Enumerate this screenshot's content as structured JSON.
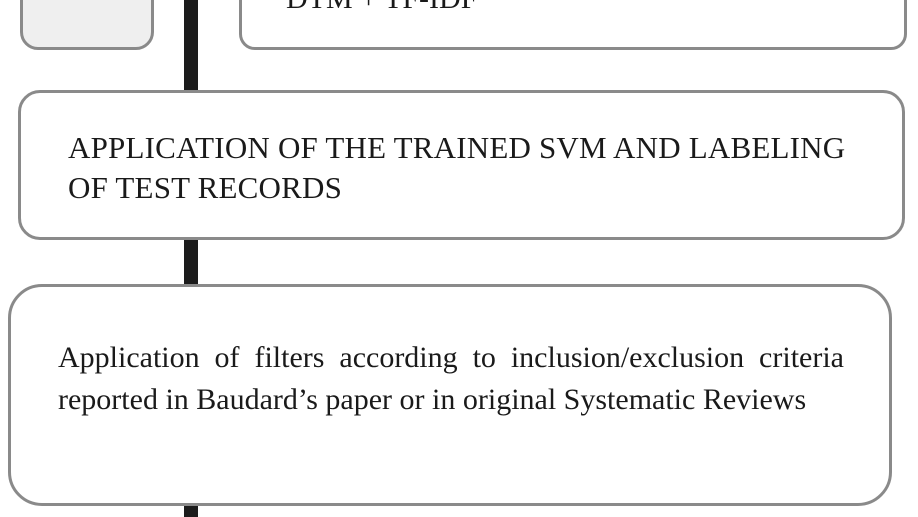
{
  "flowchart": {
    "partial_top_box_text": "DTM + TF-IDF",
    "svm_box_text": "APPLICATION OF THE TRAINED SVM AND LABELING OF TEST RECORDS",
    "filter_box_text": "Application of filters according to inclusion/exclusion criteria reported in Baudard’s paper or in original Systematic Reviews"
  },
  "colors": {
    "box_border": "#8a8a8a",
    "connector": "#1c1c1c",
    "left_box_fill": "#efefef",
    "text": "#1a1a1a"
  }
}
